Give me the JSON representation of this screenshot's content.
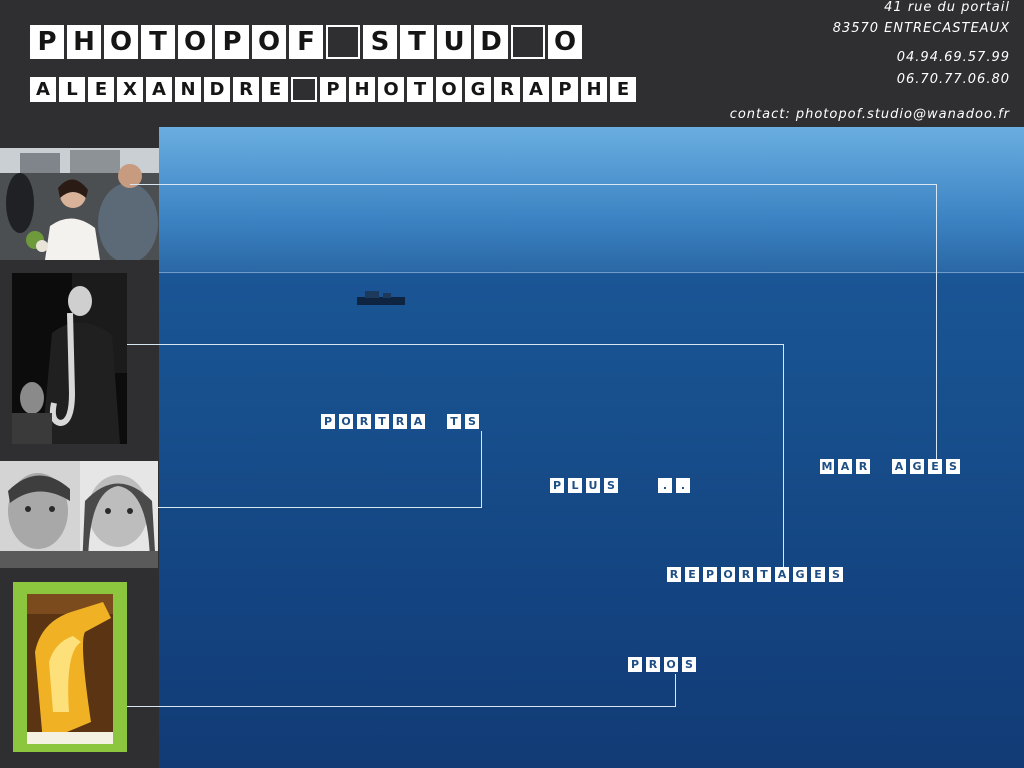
{
  "header": {
    "title_letters": [
      "P",
      "H",
      "O",
      "T",
      "O",
      "P",
      "O",
      "F",
      "",
      "S",
      "T",
      "U",
      "D",
      "",
      "O"
    ],
    "subtitle_letters": [
      "A",
      "L",
      "E",
      "X",
      "A",
      "N",
      "D",
      "R",
      "E",
      "",
      "P",
      "H",
      "O",
      "T",
      "O",
      "G",
      "R",
      "A",
      "P",
      "H",
      "E"
    ],
    "address_line1": "41 rue du portail",
    "address_line2": "83570 ENTRECASTEAUX",
    "phone1": "04.94.69.57.99",
    "phone2": "06.70.77.06.80",
    "contact": "contact: photopof.studio@wanadoo.fr"
  },
  "sidebar": {
    "thumbnails": [
      {
        "name": "wedding-photo-thumbnail"
      },
      {
        "name": "saxophonist-photo-thumbnail"
      },
      {
        "name": "portrait-couple-photo-thumbnail"
      },
      {
        "name": "bottle-product-photo-thumbnail"
      }
    ]
  },
  "menu": {
    "portraits": [
      "P",
      "O",
      "R",
      "T",
      "R",
      "A",
      "",
      "T",
      "S"
    ],
    "plus": [
      "P",
      "L",
      "U",
      "S",
      "",
      "",
      ".",
      "."
    ],
    "mariages": [
      "M",
      "A",
      "R",
      "",
      "A",
      "G",
      "E",
      "S"
    ],
    "reportages": [
      "R",
      "E",
      "P",
      "O",
      "R",
      "T",
      "A",
      "G",
      "E",
      "S"
    ],
    "pros": [
      "P",
      "R",
      "O",
      "S"
    ]
  },
  "colors": {
    "background": "#2f2f31",
    "sea": "#174f8c",
    "sky": "#6aaee0",
    "tile": "#ffffff",
    "line": "#d8e6f2"
  }
}
